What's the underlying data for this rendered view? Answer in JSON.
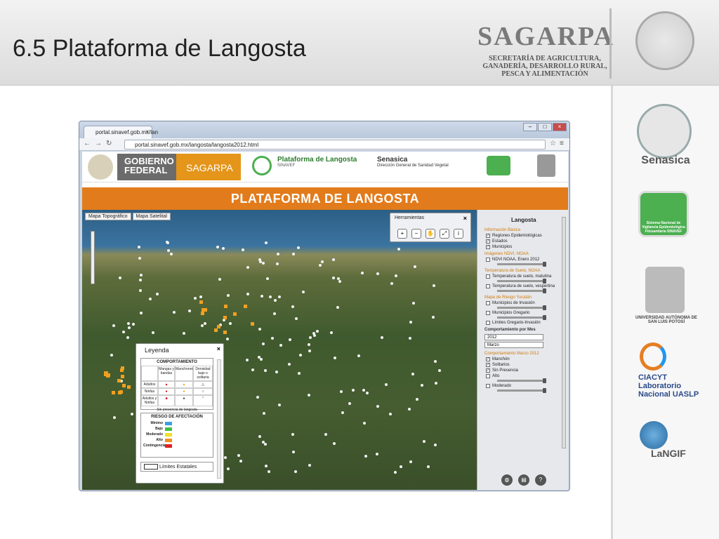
{
  "slide": {
    "title": "6.5 Plataforma de Langosta"
  },
  "sagarpa": {
    "name": "SAGARPA",
    "subtitle": "SECRETARÍA DE AGRICULTURA, GANADERÍA, DESARROLLO RURAL, PESCA Y ALIMENTACIÓN"
  },
  "right_logos": {
    "senasica": "Senasica",
    "sinavef": "Sistema Nacional de Vigilancia Epidemiológica Fitosanitaria SINAVEF",
    "uaslp": "UNIVERSIDAD AUTÓNOMA DE SAN LUIS POTOSÍ",
    "ciacyt": "CIACYT Laboratorio Nacional UASLP",
    "langif": "LaNGIF"
  },
  "browser": {
    "tab_label": "portal.sinavef.gob.mx/lan",
    "url": "portal.sinavef.gob.mx/langosta/langosta2012.html"
  },
  "site": {
    "gobierno": "GOBIERNO FEDERAL",
    "sagarpa": "SAGARPA",
    "plataforma": "Plataforma de Langosta",
    "plataforma_sub": "SINAVEF",
    "senasica": "Senasica",
    "senasica_sub": "Dirección General de Sanidad Vegetal",
    "banner": "PLATAFORMA DE LANGOSTA"
  },
  "map": {
    "map_types": [
      "Mapa Topográfico",
      "Mapa Satelital"
    ],
    "tools_title": "Herramientas"
  },
  "legend": {
    "title": "Leyenda",
    "comportamiento": "COMPORTAMIENTO",
    "columns": [
      "",
      "Mangas y bandas",
      "Manchones",
      "Densidad bajo o solitaria"
    ],
    "rows": [
      "Adultos",
      "Ninfas",
      "Adultos y Ninfas"
    ],
    "sin_presencia": "Sin presencia de langosta",
    "riesgo": "RIESGO DE AFECTACIÓN",
    "risk_levels": [
      {
        "label": "Mínimo",
        "color": "#3aa0e0"
      },
      {
        "label": "Bajo",
        "color": "#40c040"
      },
      {
        "label": "Moderado",
        "color": "#f0e020"
      },
      {
        "label": "Alto",
        "color": "#f09020"
      },
      {
        "label": "Contingencia",
        "color": "#e02020"
      }
    ],
    "limites": "Límites Estatales"
  },
  "side": {
    "title": "Langosta",
    "informacion_basica": "Información Básica",
    "regiones": "Regiones Epidemiológicas",
    "estados": "Estados",
    "municipios": "Municipios",
    "imagenes": "Imágenes NDVI, NOAA",
    "ndvi": "NDVI NOAA, Enero 2012",
    "temperatura": "Temperatura de Suelo, NOAA",
    "temp_matutina": "Temperatura de suelo, matutina",
    "temp_vespertina": "Temperatura de suelo, vespertina",
    "mapa_riesgo": "Mapa de Riesgo Yucatán",
    "mun_invasion": "Municipios de Invasión",
    "mun_gregario": "Municipios Gregario",
    "limites_gregario": "Límites Gregario-Invasión",
    "comportamiento_mes": "Comportamiento por Mes",
    "year": "2012",
    "month": "Marzo",
    "comportamiento_marzo": "Comportamiento Marzo 2012",
    "manchon": "Manchón",
    "solitarios": "Solitarios",
    "sin_presencia": "Sin Presencia",
    "alto": "Alto",
    "moderado": "Moderado"
  }
}
